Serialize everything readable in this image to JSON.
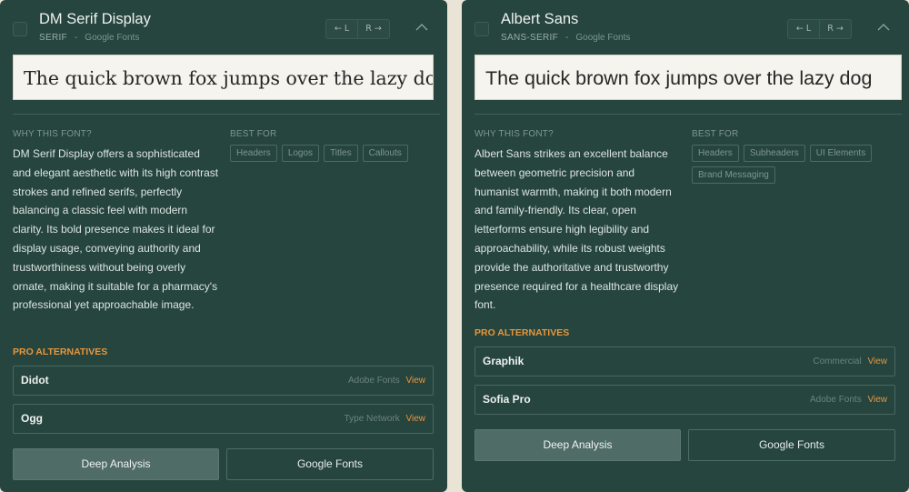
{
  "cards": [
    {
      "font_name": "DM Serif Display",
      "category": "SERIF",
      "source_sep": "-",
      "source": "Google Fonts",
      "nav_prev": "← L",
      "nav_next": "R →",
      "collapse_icon": "chevron-up",
      "preview": "The quick brown fox jumps over the lazy dog",
      "why_label": "WHY THIS FONT?",
      "why_text": "DM Serif Display offers a sophisticated and elegant aesthetic with its high contrast strokes and refined serifs, perfectly balancing a classic feel with modern clarity. Its bold presence makes it ideal for display usage, conveying authority and trustworthiness without being overly ornate, making it suitable for a pharmacy's professional yet approachable image.",
      "best_for_label": "BEST FOR",
      "best_for": [
        "Headers",
        "Logos",
        "Titles",
        "Callouts"
      ],
      "pro_label": "PRO ALTERNATIVES",
      "alternatives": [
        {
          "name": "Didot",
          "source": "Adobe Fonts",
          "view": "View"
        },
        {
          "name": "Ogg",
          "source": "Type Network",
          "view": "View"
        }
      ],
      "deep_analysis": "Deep Analysis",
      "google_fonts": "Google Fonts"
    },
    {
      "font_name": "Albert Sans",
      "category": "SANS-SERIF",
      "source_sep": "-",
      "source": "Google Fonts",
      "nav_prev": "← L",
      "nav_next": "R →",
      "collapse_icon": "chevron-up",
      "preview": "The quick brown fox jumps over the lazy dog",
      "why_label": "WHY THIS FONT?",
      "why_text": "Albert Sans strikes an excellent balance between geometric precision and humanist warmth, making it both modern and family-friendly. Its clear, open letterforms ensure high legibility and approachability, while its robust weights provide the authoritative and trustworthy presence required for a healthcare display font.",
      "best_for_label": "BEST FOR",
      "best_for": [
        "Headers",
        "Subheaders",
        "UI Elements",
        "Brand Messaging"
      ],
      "pro_label": "PRO ALTERNATIVES",
      "alternatives": [
        {
          "name": "Graphik",
          "source": "Commercial",
          "view": "View"
        },
        {
          "name": "Sofia Pro",
          "source": "Adobe Fonts",
          "view": "View"
        }
      ],
      "deep_analysis": "Deep Analysis",
      "google_fonts": "Google Fonts"
    }
  ],
  "colors": {
    "card_bg": "#26453f",
    "accent_orange": "#e8963c",
    "primary_button": "#4f6c66",
    "preview_bg": "#f6f4ee"
  }
}
